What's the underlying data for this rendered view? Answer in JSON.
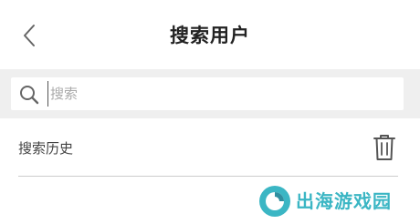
{
  "header": {
    "title": "搜索用户",
    "back_icon": "chevron-left-icon"
  },
  "search": {
    "placeholder": "搜索",
    "value": "",
    "icon": "search-icon"
  },
  "history": {
    "label": "搜索历史",
    "clear_icon": "trash-icon"
  },
  "watermark": {
    "text": "出海游戏园"
  },
  "colors": {
    "search_area_bg": "#efefef",
    "divider": "#cccccc",
    "watermark": "#3bb6c4"
  }
}
